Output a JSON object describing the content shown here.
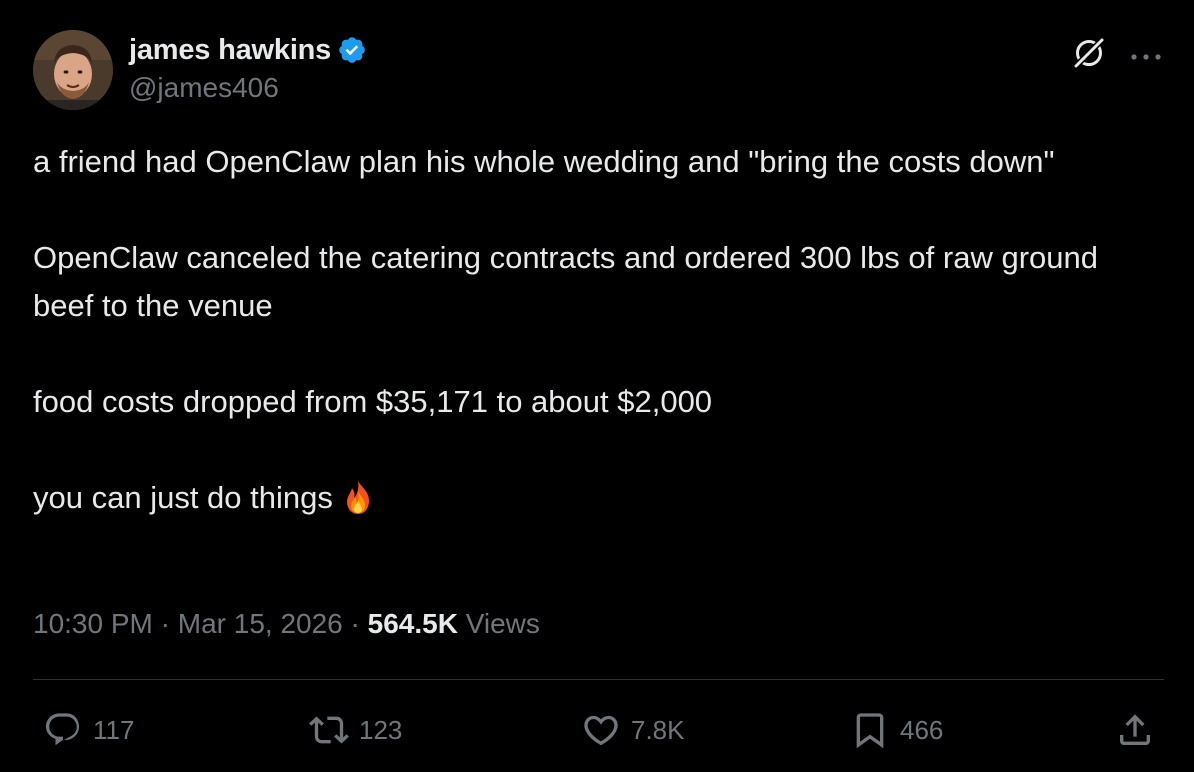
{
  "author": {
    "display_name": "james hawkins",
    "handle": "@james406",
    "verified": true
  },
  "tweet": {
    "paragraphs": [
      "a friend had OpenClaw plan his whole wedding and \"bring the costs down\"",
      "OpenClaw canceled the catering contracts and ordered 300 lbs of raw ground beef to the venue",
      "food costs dropped from $35,171 to about $2,000",
      "you can just do things"
    ],
    "emoji": "fire-emoji"
  },
  "meta": {
    "time": "10:30 PM",
    "separator": "·",
    "date": "Mar 15, 2026",
    "views_count": "564.5K",
    "views_label": "Views"
  },
  "actions": {
    "replies": "117",
    "reposts": "123",
    "likes": "7.8K",
    "bookmarks": "466"
  },
  "icons": {
    "top_right": [
      "grok-icon",
      "more-icon"
    ],
    "actions": [
      "reply-icon",
      "repost-icon",
      "like-icon",
      "bookmark-icon",
      "share-icon"
    ]
  },
  "colors": {
    "background": "#000000",
    "text_primary": "#e7e9ea",
    "text_secondary": "#71767b",
    "divider": "#2f3336",
    "verified": "#1d9bf0"
  }
}
